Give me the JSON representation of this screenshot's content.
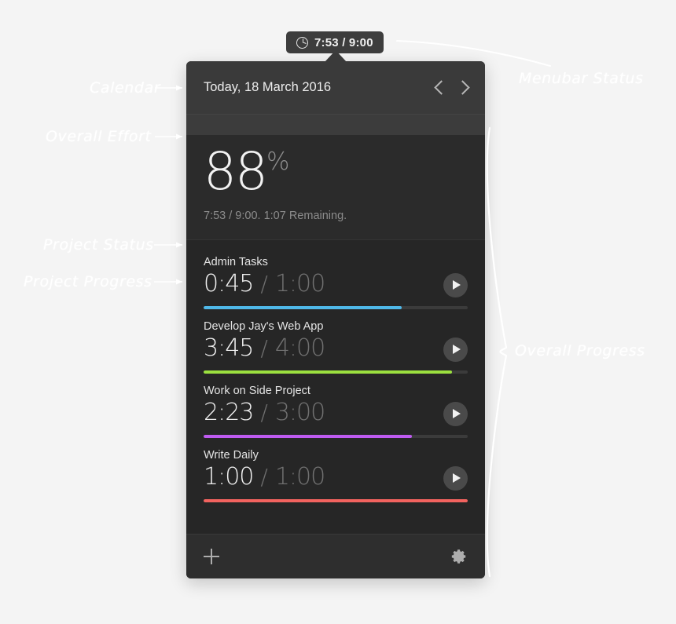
{
  "menubar": {
    "icon": "clock-icon",
    "status_text": "7:53 / 9:00"
  },
  "panel": {
    "header": {
      "date_label": "Today, 18 March 2016",
      "prev_icon": "chevron-left-icon",
      "next_icon": "chevron-right-icon"
    },
    "effort": {
      "percent": "88",
      "percent_symbol": "%",
      "summary": "7:53 / 9:00. 1:07 Remaining."
    },
    "tasks": [
      {
        "name": "Admin Tasks",
        "elapsed": "0:45",
        "separator": "/",
        "total": "1:00",
        "progress": 75,
        "color": "#4FB8E8",
        "play_icon": "play-icon"
      },
      {
        "name": "Develop Jay's Web App",
        "elapsed": "3:45",
        "separator": "/",
        "total": "4:00",
        "progress": 94,
        "color": "#9BE03F",
        "play_icon": "play-icon"
      },
      {
        "name": "Work on Side Project",
        "elapsed": "2:23",
        "separator": "/",
        "total": "3:00",
        "progress": 79,
        "color": "#BE5BF0",
        "play_icon": "play-icon"
      },
      {
        "name": "Write Daily",
        "elapsed": "1:00",
        "separator": "/",
        "total": "1:00",
        "progress": 100,
        "color": "#F2635F",
        "play_icon": "play-icon"
      }
    ],
    "footer": {
      "add_icon": "plus-icon",
      "settings_icon": "gear-icon"
    }
  },
  "annotations": {
    "calendar": "Calendar",
    "overall_effort": "Overall Effort",
    "project_status": "Project Status",
    "project_progress": "Project Progress",
    "menubar_status": "Menubar Status",
    "overall_progress": "Overall Progress"
  },
  "colors": {
    "background": "#f4f4f4",
    "panel": "#262626",
    "header": "#3a3a3a",
    "annotation": "#ffffff"
  }
}
